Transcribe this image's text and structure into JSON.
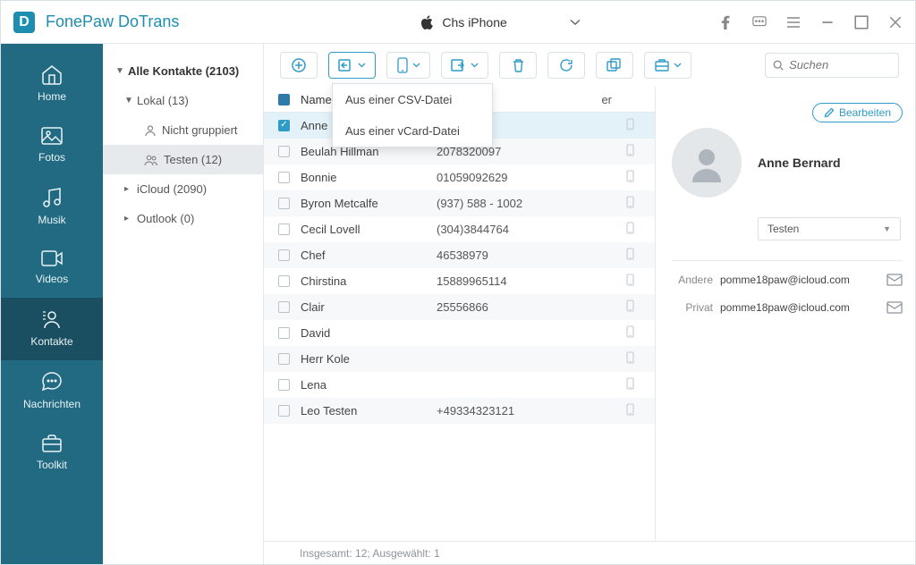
{
  "app": {
    "title": "FonePaw DoTrans",
    "device": "Chs iPhone"
  },
  "sidebar": {
    "items": [
      {
        "label": "Home"
      },
      {
        "label": "Fotos"
      },
      {
        "label": "Musik"
      },
      {
        "label": "Videos"
      },
      {
        "label": "Kontakte"
      },
      {
        "label": "Nachrichten"
      },
      {
        "label": "Toolkit"
      }
    ]
  },
  "tree": {
    "root": "Alle Kontakte  (2103)",
    "lokal": "Lokal  (13)",
    "nicht_gruppiert": "Nicht gruppiert",
    "testen": "Testen  (12)",
    "icloud": "iCloud  (2090)",
    "outlook": "Outlook  (0)"
  },
  "dropdown": {
    "csv": "Aus einer CSV-Datei",
    "vcard": "Aus einer vCard-Datei"
  },
  "columns": {
    "name": "Name",
    "phone_tail": "er"
  },
  "contacts": [
    {
      "name": "Anne Bernard",
      "phone": "",
      "selected": true
    },
    {
      "name": "Beulah Hillman",
      "phone": "2078320097"
    },
    {
      "name": "Bonnie",
      "phone": "01059092629"
    },
    {
      "name": "Byron Metcalfe",
      "phone": "(937) 588 - 1002"
    },
    {
      "name": "Cecil Lovell",
      "phone": "(304)3844764"
    },
    {
      "name": "Chef",
      "phone": "46538979"
    },
    {
      "name": "Chirstina",
      "phone": "15889965114"
    },
    {
      "name": "Clair",
      "phone": "25556866"
    },
    {
      "name": "David",
      "phone": ""
    },
    {
      "name": "Herr Kole",
      "phone": ""
    },
    {
      "name": "Lena",
      "phone": ""
    },
    {
      "name": "Leo Testen",
      "phone": "+49334323121"
    }
  ],
  "status": "Insgesamt: 12; Ausgewählt: 1",
  "search": {
    "placeholder": "Suchen"
  },
  "detail": {
    "edit": "Bearbeiten",
    "name": "Anne Bernard",
    "group": "Testen",
    "fields": [
      {
        "label": "Andere",
        "value": "pomme18paw@icloud.com"
      },
      {
        "label": "Privat",
        "value": "pomme18paw@icloud.com"
      }
    ]
  }
}
